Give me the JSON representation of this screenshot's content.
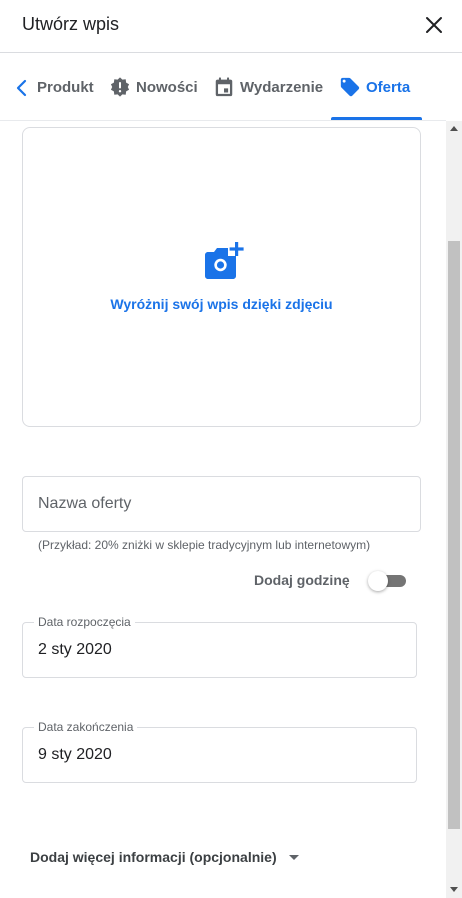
{
  "header": {
    "title": "Utwórz wpis",
    "close_icon": "close-icon"
  },
  "tabs": {
    "back_icon": "chevron-left-icon",
    "items": [
      {
        "label": "Produkt",
        "icon": "none",
        "active": false
      },
      {
        "label": "Nowości",
        "icon": "news-badge-icon",
        "active": false
      },
      {
        "label": "Wydarzenie",
        "icon": "calendar-icon",
        "active": false
      },
      {
        "label": "Oferta",
        "icon": "tag-icon",
        "active": true
      }
    ]
  },
  "photo": {
    "icon": "add-photo-icon",
    "label": "Wyróżnij swój wpis dzięki zdjęciu"
  },
  "offer": {
    "placeholder": "Nazwa oferty",
    "helper": "(Przykład: 20% zniżki w sklepie tradycyjnym lub internetowym)"
  },
  "add_hour": {
    "label": "Dodaj godzinę",
    "enabled": false
  },
  "start_date": {
    "label": "Data rozpoczęcia",
    "value": "2 sty 2020"
  },
  "end_date": {
    "label": "Data zakończenia",
    "value": "9 sty 2020"
  },
  "more": {
    "label": "Dodaj więcej informacji (opcjonalnie)",
    "icon": "caret-down-icon"
  },
  "colors": {
    "accent": "#1a73e8",
    "text_primary": "#202124",
    "text_secondary": "#5f6368",
    "border": "#dadce0"
  }
}
